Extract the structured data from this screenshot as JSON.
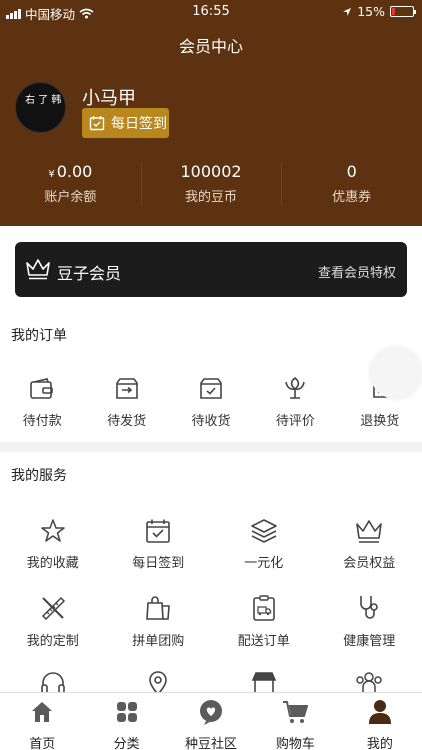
{
  "status_bar": {
    "carrier": "中国移动",
    "time": "16:55",
    "battery": "15%",
    "battery_level": 0.15
  },
  "header": {
    "title": "会员中心"
  },
  "profile": {
    "avatar_text": "右 了 韩",
    "username": "小马甲",
    "checkin_label": "每日签到"
  },
  "stats": [
    {
      "currency": "¥",
      "value": "0.00",
      "label": "账户余额"
    },
    {
      "currency": "",
      "value": "100002",
      "label": "我的豆币"
    },
    {
      "currency": "",
      "value": "0",
      "label": "优惠券"
    }
  ],
  "vip": {
    "name": "豆子会员",
    "link": "查看会员特权"
  },
  "orders": {
    "title": "我的订单",
    "items": [
      {
        "label": "待付款",
        "icon": "wallet-icon"
      },
      {
        "label": "待发货",
        "icon": "box-ship-icon"
      },
      {
        "label": "待收货",
        "icon": "box-check-icon"
      },
      {
        "label": "待评价",
        "icon": "flower-icon"
      },
      {
        "label": "退换货",
        "icon": "return-icon"
      }
    ]
  },
  "services": {
    "title": "我的服务",
    "items": [
      {
        "label": "我的收藏",
        "icon": "star-icon"
      },
      {
        "label": "每日签到",
        "icon": "calendar-check-icon"
      },
      {
        "label": "一元化",
        "icon": "layers-icon"
      },
      {
        "label": "会员权益",
        "icon": "crown-icon"
      },
      {
        "label": "我的定制",
        "icon": "ruler-pencil-icon"
      },
      {
        "label": "拼单团购",
        "icon": "shopping-bags-icon"
      },
      {
        "label": "配送订单",
        "icon": "delivery-doc-icon"
      },
      {
        "label": "健康管理",
        "icon": "stethoscope-icon"
      },
      {
        "label": "",
        "icon": "headset-icon"
      },
      {
        "label": "",
        "icon": "location-pin-icon"
      },
      {
        "label": "",
        "icon": "store-icon"
      },
      {
        "label": "",
        "icon": "group-icon"
      }
    ]
  },
  "tabbar": [
    {
      "label": "首页",
      "icon": "home-icon"
    },
    {
      "label": "分类",
      "icon": "category-icon"
    },
    {
      "label": "种豆社区",
      "icon": "community-icon"
    },
    {
      "label": "购物车",
      "icon": "cart-icon"
    },
    {
      "label": "我的",
      "icon": "profile-icon",
      "active": true
    }
  ],
  "colors": {
    "header_bg": "#5c3210",
    "accent_gold": "#b8871d",
    "vip_bg": "#1c1c1c"
  }
}
